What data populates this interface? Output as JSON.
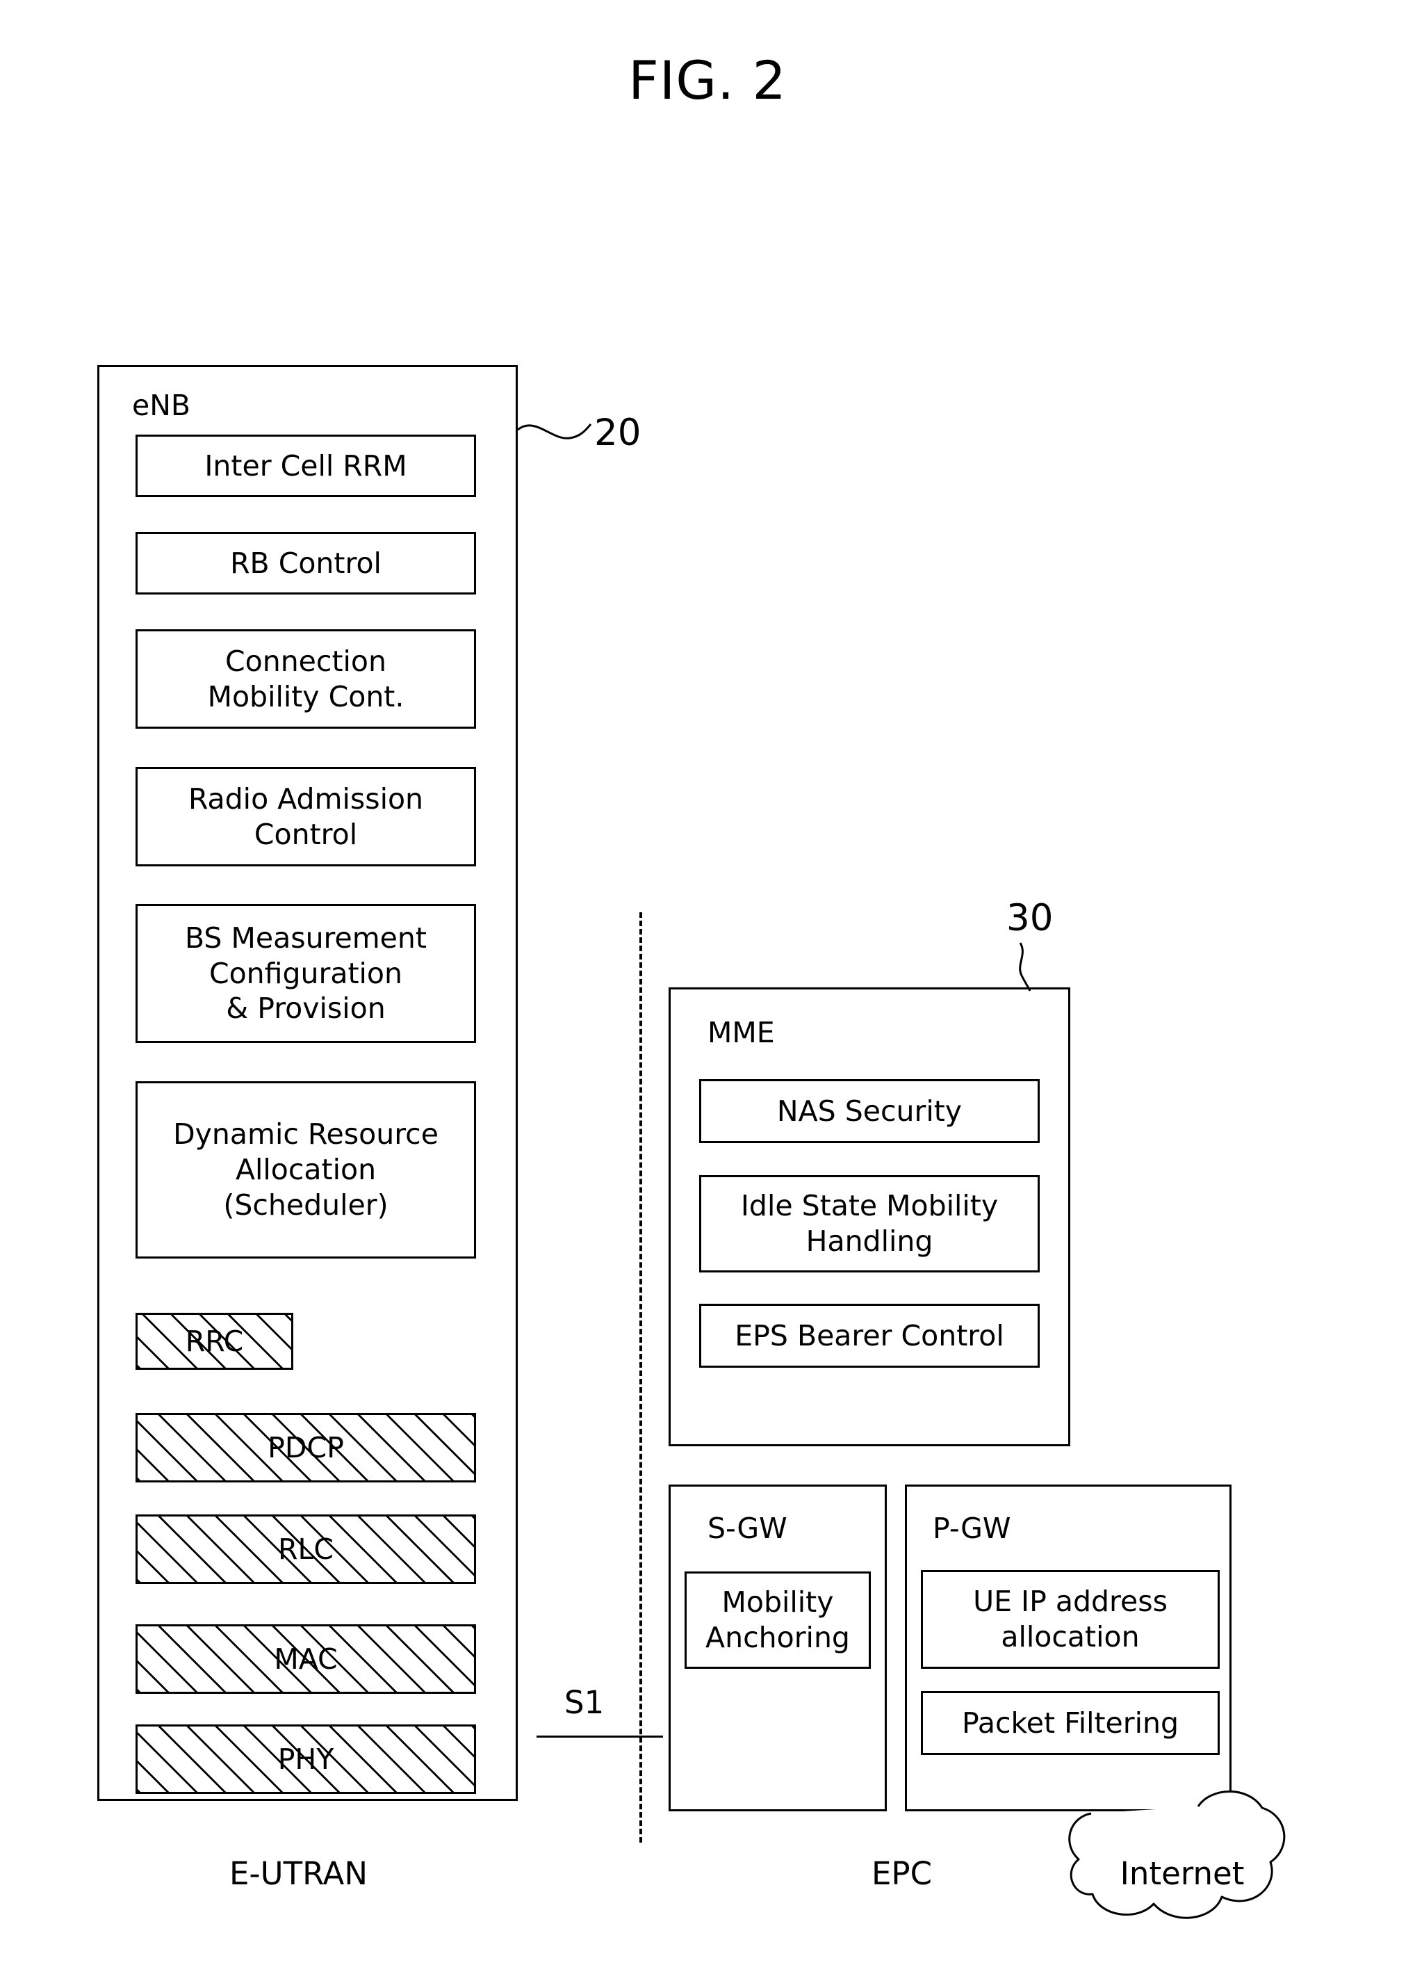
{
  "figure": {
    "title": "FIG. 2"
  },
  "enb": {
    "title": "eNB",
    "ref": "20",
    "caption": "E-UTRAN",
    "functions": [
      {
        "label": "Inter Cell RRM"
      },
      {
        "label": "RB Control"
      },
      {
        "label": "Connection\nMobility Cont."
      },
      {
        "label": "Radio Admission\nControl"
      },
      {
        "label": "BS Measurement\nConfiguration\n& Provision"
      },
      {
        "label": "Dynamic Resource\nAllocation\n(Scheduler)"
      }
    ],
    "protocol_stack": [
      {
        "label": "RRC"
      },
      {
        "label": "PDCP"
      },
      {
        "label": "RLC"
      },
      {
        "label": "MAC"
      },
      {
        "label": "PHY"
      }
    ]
  },
  "interface": {
    "label": "S1"
  },
  "epc": {
    "caption": "EPC",
    "ref": "30",
    "mme": {
      "title": "MME",
      "functions": [
        {
          "label": "NAS Security"
        },
        {
          "label": "Idle State Mobility\nHandling"
        },
        {
          "label": "EPS Bearer Control"
        }
      ]
    },
    "sgw": {
      "title": "S-GW",
      "functions": [
        {
          "label": "Mobility\nAnchoring"
        }
      ]
    },
    "pgw": {
      "title": "P-GW",
      "functions": [
        {
          "label": "UE IP address\nallocation"
        },
        {
          "label": "Packet Filtering"
        }
      ]
    }
  },
  "internet": {
    "label": "Internet"
  }
}
